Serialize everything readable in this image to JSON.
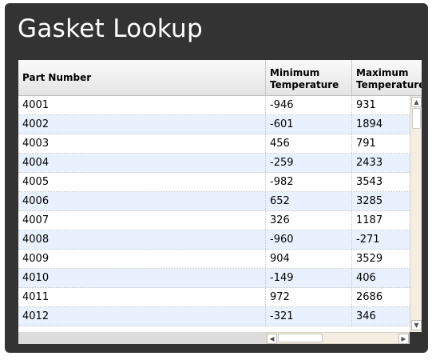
{
  "page": {
    "title": "Gasket Lookup"
  },
  "grid": {
    "columns": [
      {
        "label": "Part Number"
      },
      {
        "label_line1": "Minimum",
        "label_line2": "Temperature"
      },
      {
        "label_line1": "Maximum",
        "label_line2": "Temperature"
      }
    ],
    "rows": [
      {
        "part": "4001",
        "min": "-946",
        "max": "931"
      },
      {
        "part": "4002",
        "min": "-601",
        "max": "1894"
      },
      {
        "part": "4003",
        "min": "456",
        "max": "791"
      },
      {
        "part": "4004",
        "min": "-259",
        "max": "2433"
      },
      {
        "part": "4005",
        "min": "-982",
        "max": "3543"
      },
      {
        "part": "4006",
        "min": "652",
        "max": "3285"
      },
      {
        "part": "4007",
        "min": "326",
        "max": "1187"
      },
      {
        "part": "4008",
        "min": "-960",
        "max": "-271"
      },
      {
        "part": "4009",
        "min": "904",
        "max": "3529"
      },
      {
        "part": "4010",
        "min": "-149",
        "max": "406"
      },
      {
        "part": "4011",
        "min": "972",
        "max": "2686"
      },
      {
        "part": "4012",
        "min": "-321",
        "max": "346"
      }
    ]
  },
  "scrollbars": {
    "up_glyph": "▲",
    "down_glyph": "▼",
    "left_glyph": "◀",
    "right_glyph": "▶"
  }
}
